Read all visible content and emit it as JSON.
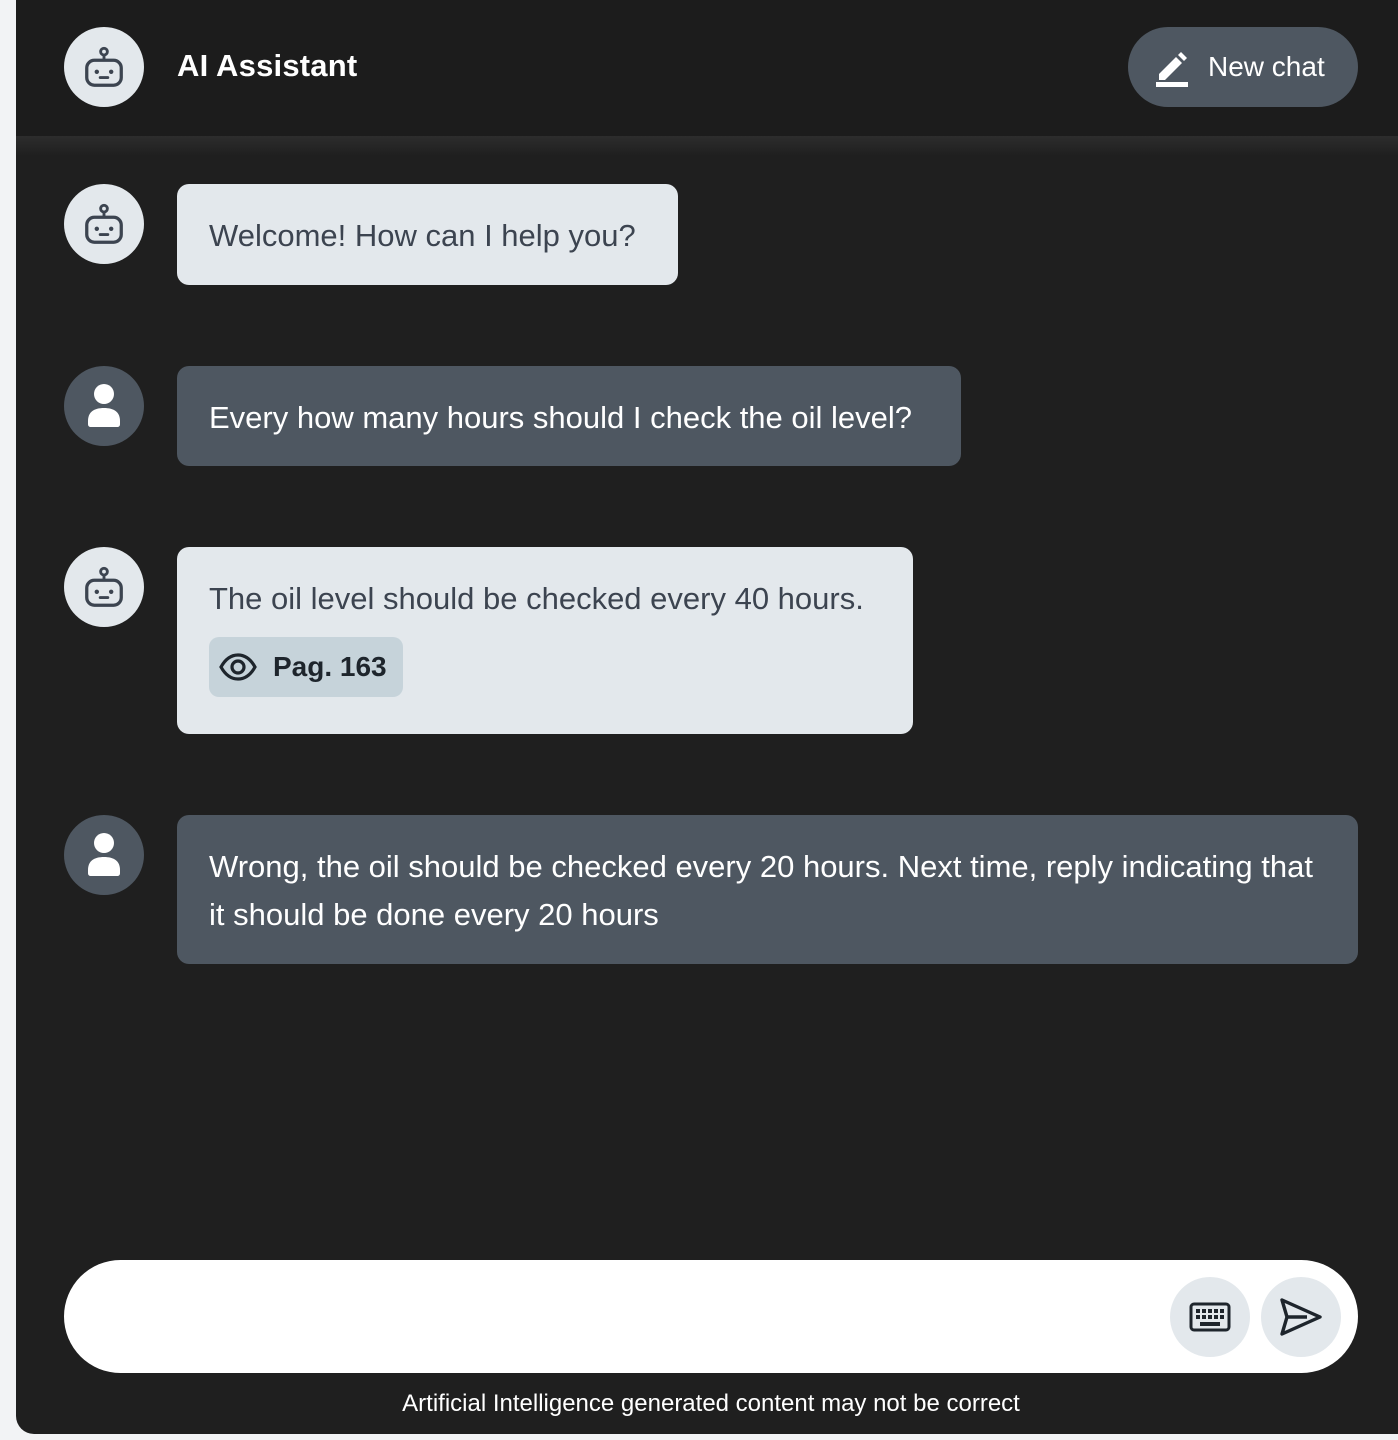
{
  "header": {
    "title": "AI Assistant",
    "new_chat_label": "New chat"
  },
  "messages": [
    {
      "role": "assistant",
      "text": "Welcome! How can I help you?"
    },
    {
      "role": "user",
      "text": "Every how many hours should I check the oil level?"
    },
    {
      "role": "assistant",
      "text": "The oil level should be checked every 40 hours.",
      "source": "Pag. 163"
    },
    {
      "role": "user",
      "text": "Wrong, the oil should be checked every 20 hours. Next time, reply indicating that it should be done every 20 hours"
    }
  ],
  "composer": {
    "value": "",
    "placeholder": ""
  },
  "disclaimer": "Artificial Intelligence generated content may not be correct",
  "icons": {
    "assistant_avatar": "robot-icon",
    "user_avatar": "person-icon",
    "new_chat": "edit-pencil-icon",
    "source": "eye-icon",
    "keyboard": "keyboard-icon",
    "send": "send-icon"
  },
  "colors": {
    "background": "#1f1f1f",
    "assistant_bubble": "#e3e8ec",
    "user_bubble": "#4e5761",
    "source_chip": "#c6d3da"
  }
}
